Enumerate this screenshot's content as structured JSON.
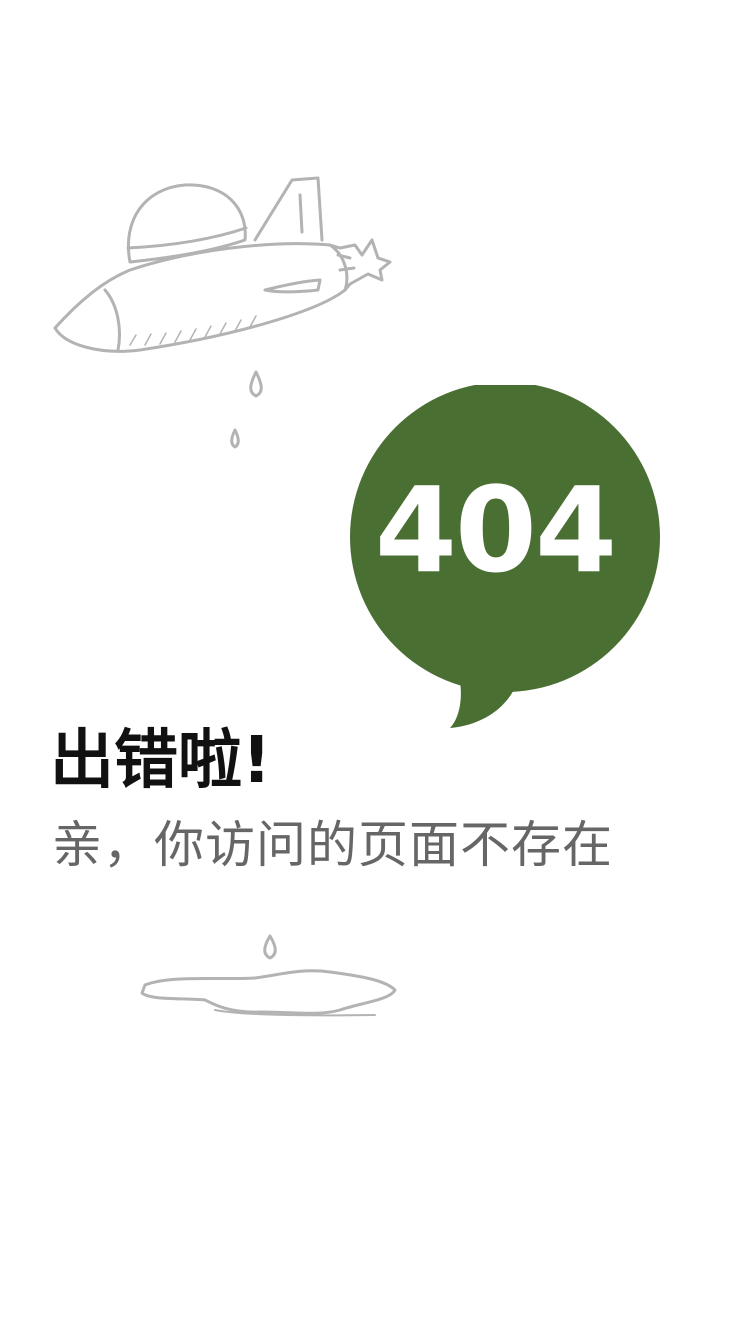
{
  "illustration": {
    "rocket": "rocket-sketch",
    "drops": "water-drop-icon",
    "puddle": "puddle-sketch",
    "line_color": "#b3b3b3"
  },
  "bubble": {
    "code": "404",
    "color": "#4a6f33",
    "text_color": "#ffffff"
  },
  "error": {
    "title": "出错啦!",
    "message": "亲，你访问的页面不存在"
  }
}
